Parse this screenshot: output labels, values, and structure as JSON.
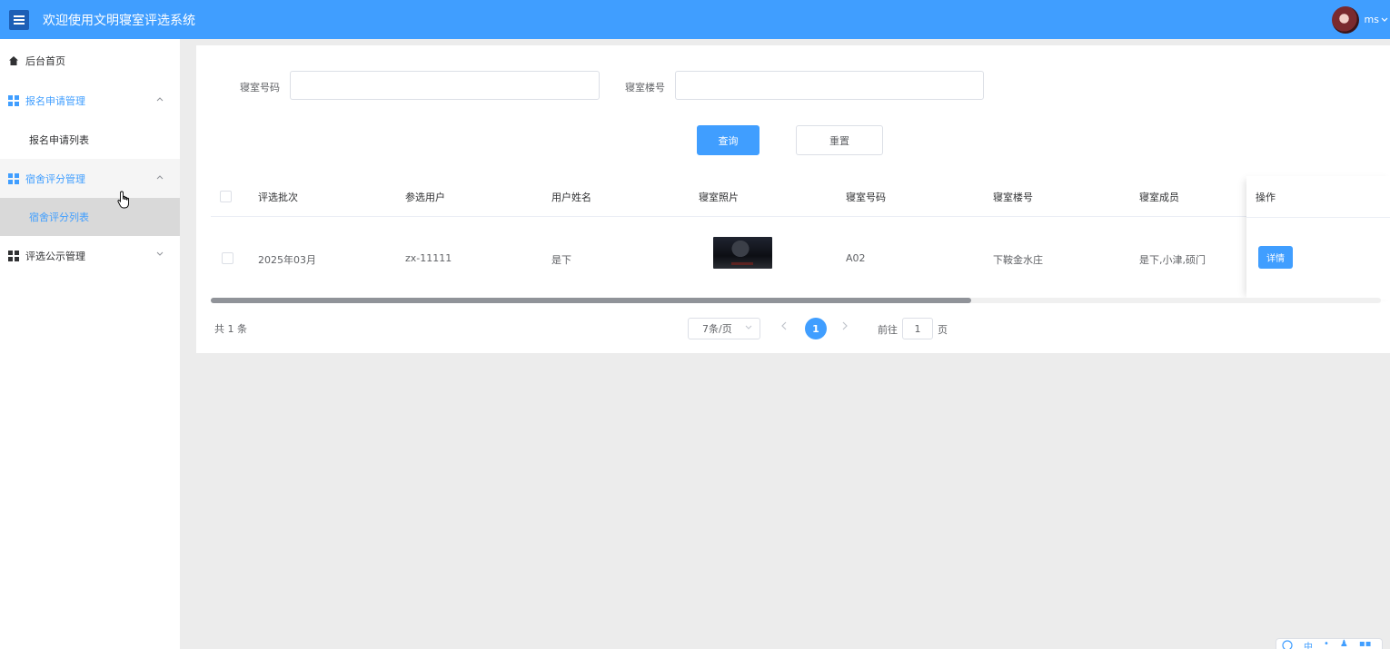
{
  "header": {
    "title": "欢迎使用文明寝室评选系统",
    "user_name": "ms",
    "menu_icon": "hamburger-menu-icon",
    "colors": {
      "header_bg": "#409eff",
      "accent": "#409eff"
    }
  },
  "sidebar": {
    "items": [
      {
        "label": "后台首页",
        "icon": "home-icon"
      },
      {
        "label": "报名申请管理",
        "icon": "grid-icon",
        "expanded": true,
        "children": [
          {
            "label": "报名申请列表"
          }
        ]
      },
      {
        "label": "宿舍评分管理",
        "icon": "grid-icon",
        "expanded": true,
        "children": [
          {
            "label": "宿舍评分列表",
            "current": true
          }
        ]
      },
      {
        "label": "评选公示管理",
        "icon": "grid-icon",
        "expanded": false
      }
    ]
  },
  "search": {
    "field1_label": "寝室号码",
    "field1_value": "",
    "field2_label": "寝室楼号",
    "field2_value": "",
    "query_button": "查询",
    "reset_button": "重置"
  },
  "table": {
    "headers": [
      "评选批次",
      "参选用户",
      "用户姓名",
      "寝室照片",
      "寝室号码",
      "寝室楼号",
      "寝室成员",
      "操作"
    ],
    "rows": [
      {
        "batch": "2025年03月",
        "user": "zx-11111",
        "name": "是下",
        "room_no": "A02",
        "building": "下鞍金水庄",
        "members": "是下,小津,硕门",
        "action": "详情"
      }
    ]
  },
  "pagination": {
    "total_text": "共 1 条",
    "page_size": "7条/页",
    "current_page": "1",
    "goto_label": "前往",
    "goto_value": "1",
    "goto_unit": "页"
  },
  "corner_widget": {
    "label": "中"
  }
}
